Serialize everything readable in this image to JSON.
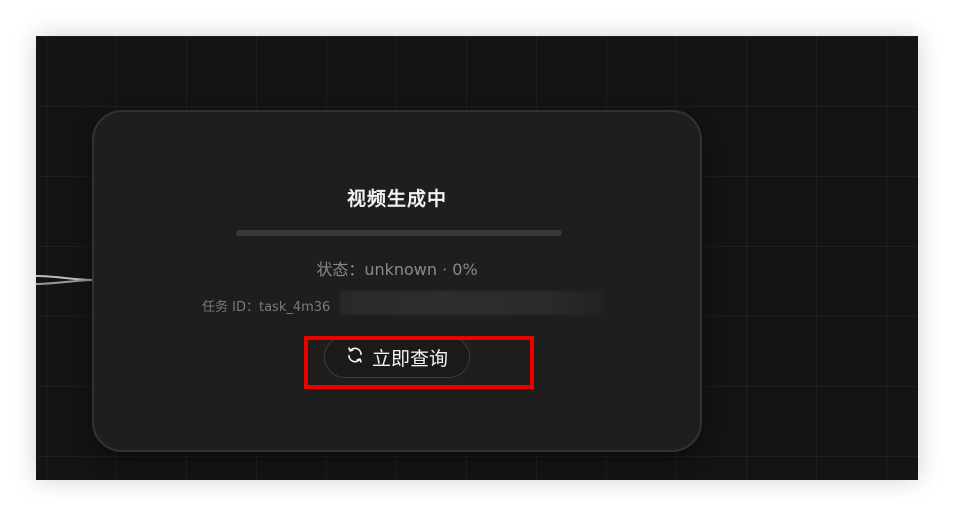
{
  "node": {
    "title": "视频生成中",
    "progress_fraction": 0.0,
    "status_text": "状态：unknown · 0%",
    "task_id_text": "任务 ID：task_4m36",
    "query_button_label": "立即查询"
  },
  "icons": {
    "query_button_icon": "refresh-icon"
  },
  "colors": {
    "canvas_background": "#141414",
    "card_background": "#1f1e1d",
    "highlight": "#ee0000"
  }
}
